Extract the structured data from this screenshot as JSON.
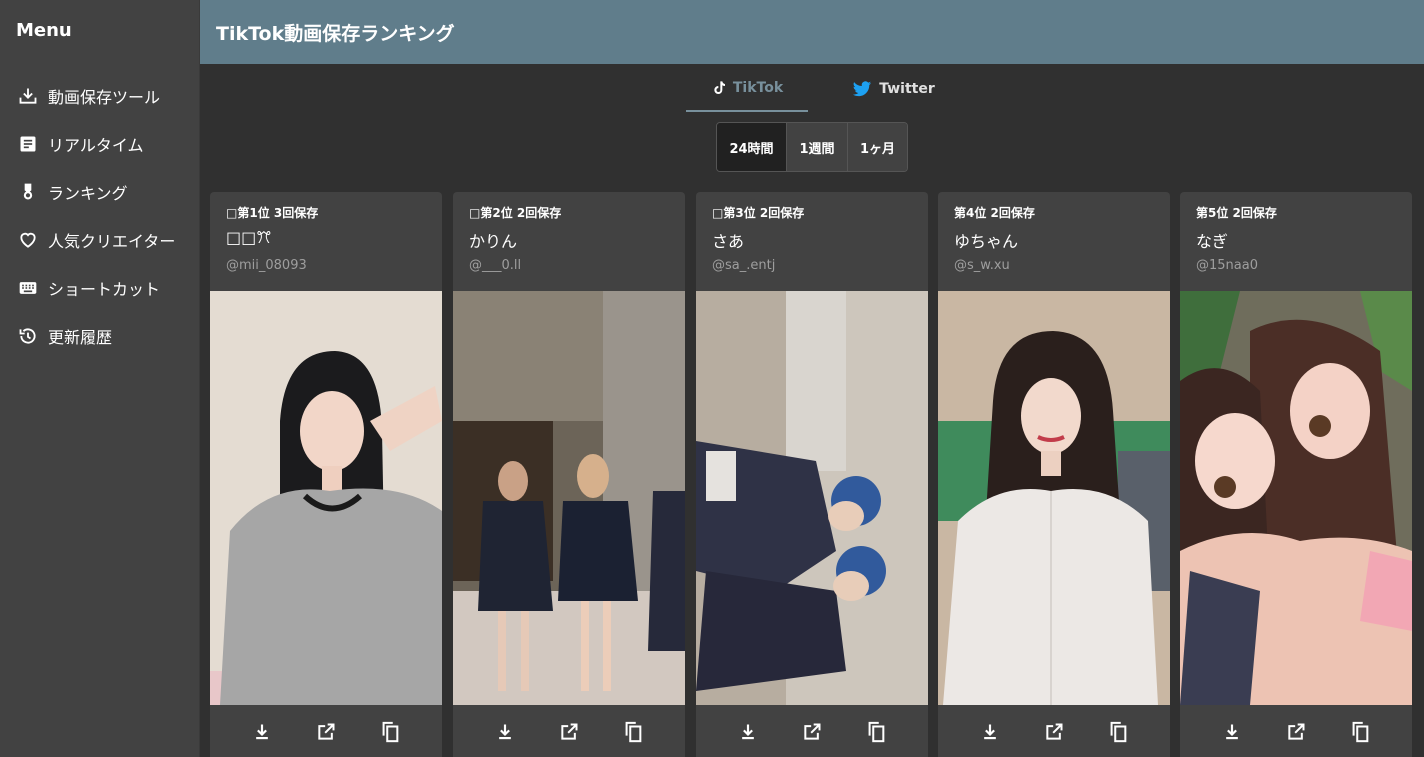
{
  "sidebar": {
    "title": "Menu",
    "items": [
      {
        "label": "動画保存ツール",
        "icon": "download-tray-icon"
      },
      {
        "label": "リアルタイム",
        "icon": "article-icon"
      },
      {
        "label": "ランキング",
        "icon": "medal-icon"
      },
      {
        "label": "人気クリエイター",
        "icon": "heart-icon"
      },
      {
        "label": "ショートカット",
        "icon": "keyboard-icon"
      },
      {
        "label": "更新履歴",
        "icon": "history-icon"
      }
    ]
  },
  "header": {
    "title": "TikTok動画保存ランキング"
  },
  "tabs": [
    {
      "label": "TikTok",
      "icon": "tiktok-icon",
      "active": true
    },
    {
      "label": "Twitter",
      "icon": "twitter-bird-icon",
      "active": false
    }
  ],
  "period": {
    "options": [
      "24時間",
      "1週間",
      "1ヶ月"
    ],
    "selected": "24時間"
  },
  "cards": [
    {
      "rank": "□第1位 3回保存",
      "name": "□□ꔫ",
      "handle": "@mii_08093"
    },
    {
      "rank": "□第2位 2回保存",
      "name": "かりん",
      "handle": "@___0.ll"
    },
    {
      "rank": "□第3位 2回保存",
      "name": "さあ",
      "handle": "@sa_.entj"
    },
    {
      "rank": "第4位 2回保存",
      "name": "ゆちゃん",
      "handle": "@s_w.xu"
    },
    {
      "rank": "第5位 2回保存",
      "name": "なぎ",
      "handle": "@15naa0"
    }
  ],
  "card_actions": [
    "download-icon",
    "open-in-new-icon",
    "copy-icon"
  ],
  "colors": {
    "appbar": "#607d8b",
    "sidebar": "#424242",
    "background": "#303030",
    "card": "#424242",
    "active_tab": "#78909c",
    "twitter_blue": "#1da1f2"
  }
}
